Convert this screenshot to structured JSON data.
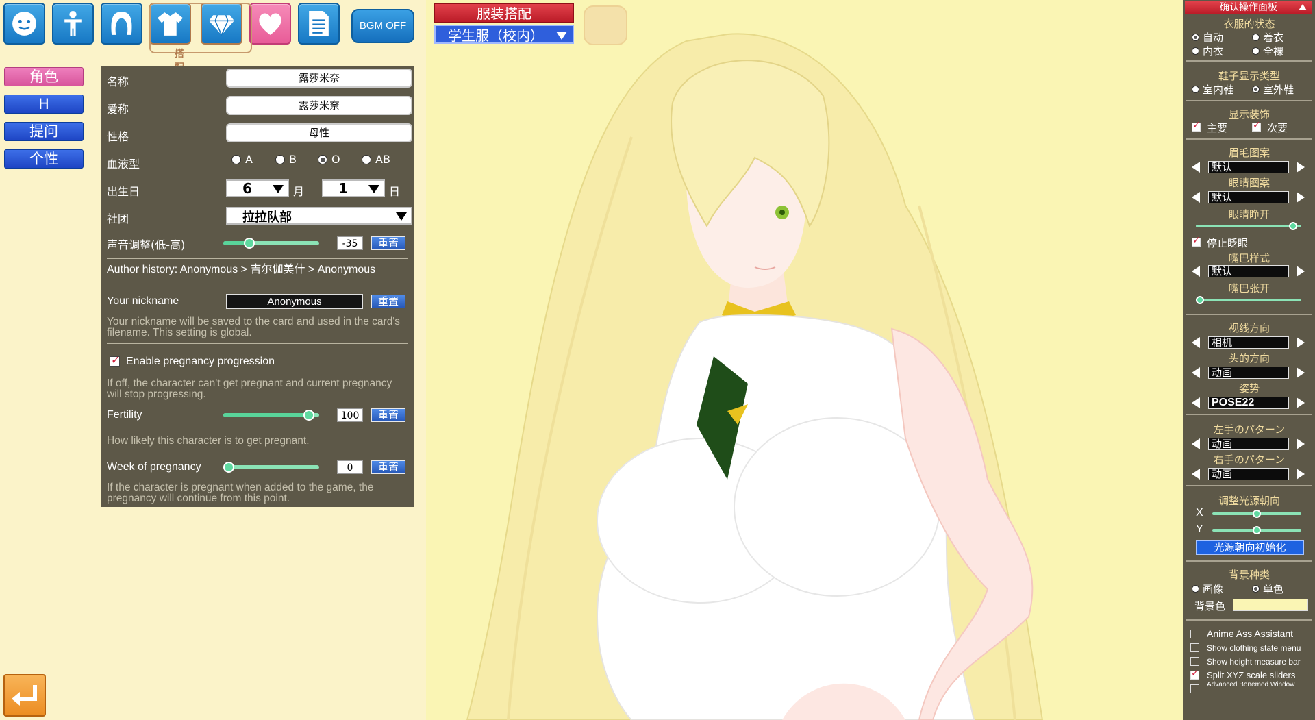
{
  "toolbar": {
    "buttons": [
      {
        "icon": "face-icon"
      },
      {
        "icon": "body-icon"
      },
      {
        "icon": "hair-icon"
      },
      {
        "icon": "shirt-icon"
      },
      {
        "icon": "diamond-icon"
      },
      {
        "icon": "heart-icon"
      },
      {
        "icon": "document-icon"
      }
    ],
    "group_label": "搭配类型",
    "bgm_label": "BGM OFF"
  },
  "left_tabs": [
    "角色",
    "H",
    "提问",
    "个性"
  ],
  "character": {
    "name_label": "名称",
    "name_value": "露莎米奈",
    "nickname_label": "爱称",
    "nickname_value": "露莎米奈",
    "personality_label": "性格",
    "personality_value": "母性",
    "blood_label": "血液型",
    "blood_options": [
      "A",
      "B",
      "O",
      "AB"
    ],
    "blood_selected": "O",
    "birthday_label": "出生日",
    "birth_month": "6",
    "month_unit": "月",
    "birth_day": "1",
    "day_unit": "日",
    "club_label": "社团",
    "club_value": "拉拉队部",
    "voice_label": "声音调整(低-高)",
    "voice_value": "-35",
    "voice_level": 0.24,
    "reset_label": "重置",
    "author_history": "Author history: Anonymous > 吉尔伽美什 > Anonymous",
    "your_nickname_label": "Your nickname",
    "your_nickname_value": "Anonymous",
    "nickname_help": "Your nickname will be saved to the card and used in the card's filename. This setting is global.",
    "pregnancy_toggle_label": "Enable pregnancy progression",
    "pregnancy_toggle_on": true,
    "pregnancy_help": "If off, the character can't get pregnant and current pregnancy will stop progressing.",
    "fertility_label": "Fertility",
    "fertility_value": "100",
    "fertility_level": 0.94,
    "fertility_help": "How likely this character is to get pregnant.",
    "week_label": "Week of pregnancy",
    "week_value": "0",
    "week_level": 0.0,
    "week_help": "If the character is pregnant when added to the game, the pregnancy will continue from this point."
  },
  "outfit": {
    "title": "服装搭配",
    "selected": "学生服（校内）"
  },
  "right_panel": {
    "header": "确认操作面板",
    "clothing_state_title": "衣服的状态",
    "clothing_state_options": [
      "自动",
      "着衣",
      "内衣",
      "全裸"
    ],
    "clothing_state_selected": "自动",
    "shoe_title": "鞋子显示类型",
    "shoe_options": [
      "室内鞋",
      "室外鞋"
    ],
    "shoe_selected": "室外鞋",
    "accessory_title": "显示装饰",
    "accessory_main": "主要",
    "accessory_sub": "次要",
    "eyebrow_title": "眉毛图案",
    "eyebrow_value": "默认",
    "eye_title": "眼睛图案",
    "eye_value": "默认",
    "eye_open_title": "眼睛睁开",
    "eye_open_level": 0.96,
    "stop_blink_label": "停止眨眼",
    "mouth_title": "嘴巴样式",
    "mouth_value": "默认",
    "mouth_open_title": "嘴巴张开",
    "mouth_open_level": 0.0,
    "gaze_title": "视线方向",
    "gaze_value": "相机",
    "head_title": "头的方向",
    "head_value": "动画",
    "pose_title": "姿势",
    "pose_value": "POSE22",
    "lhand_title": "左手のパターン",
    "lhand_value": "动画",
    "rhand_title": "右手のパターン",
    "rhand_value": "动画",
    "light_title": "调整光源朝向",
    "light_x_label": "X",
    "light_x_level": 0.5,
    "light_y_label": "Y",
    "light_y_level": 0.5,
    "light_reset": "光源朝向初始化",
    "bg_title": "背景种类",
    "bg_options": [
      "画像",
      "单色"
    ],
    "bg_selected": "单色",
    "bg_color_label": "背景色",
    "bg_color": "#faf5b4",
    "checks": [
      {
        "label": "Anime Ass Assistant",
        "on": false
      },
      {
        "label": "Show clothing state menu",
        "on": false
      },
      {
        "label": "Show height measure bar",
        "on": false
      },
      {
        "label": "Split XYZ scale sliders",
        "on": true
      },
      {
        "label": "Advanced Bonemod Window",
        "on": false
      }
    ]
  },
  "colors": {
    "panel": "#5d5848",
    "accent_blue": "#1e62e0",
    "accent_red": "#bb1c28",
    "slider_green": "#5fd9a0",
    "viewport_bg": "#faf5b4"
  }
}
